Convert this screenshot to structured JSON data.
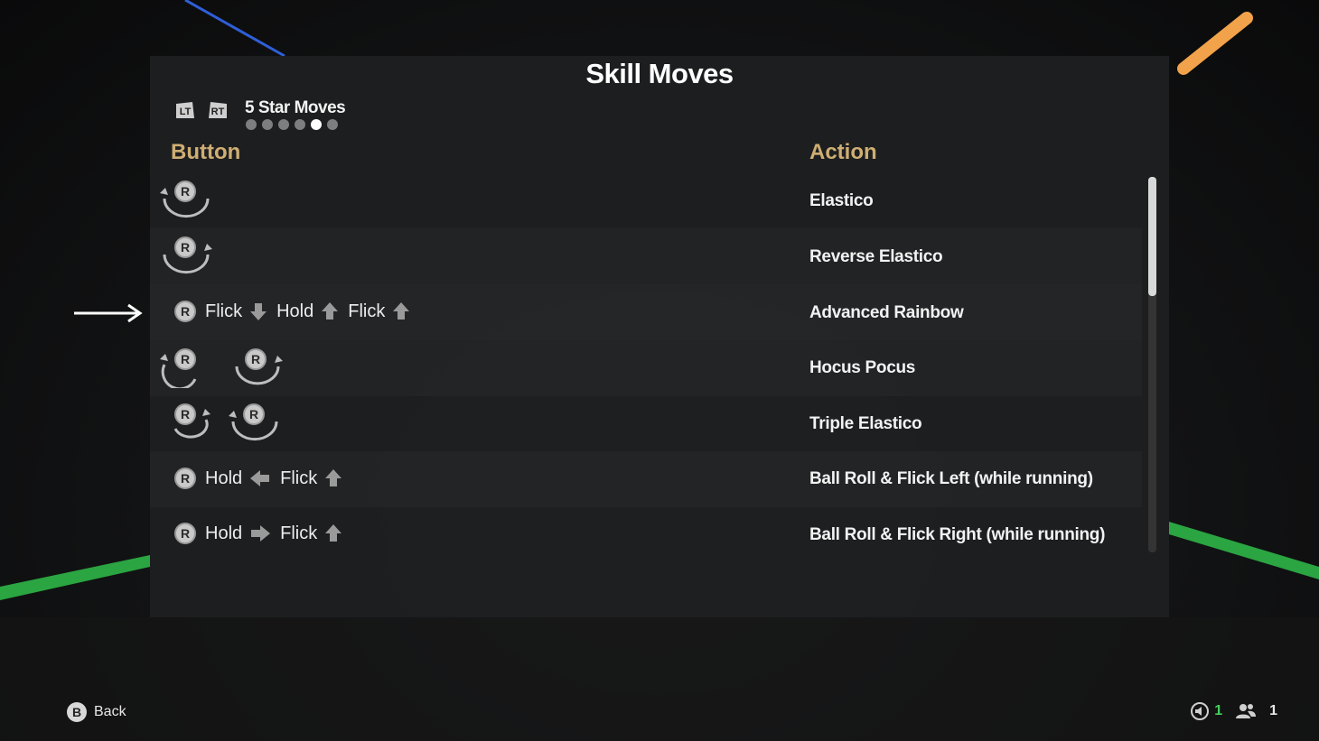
{
  "header": {
    "title": "Skill Moves",
    "left_bumper": "LT",
    "right_bumper": "RT",
    "current_tab": "5 Star Moves",
    "page_count": 6,
    "active_page": 5
  },
  "columns": {
    "button": "Button",
    "action": "Action"
  },
  "rows": [
    {
      "action": "Elastico"
    },
    {
      "action": "Reverse Elastico"
    },
    {
      "action": "Advanced Rainbow",
      "words": [
        "Flick",
        "Hold",
        "Flick"
      ]
    },
    {
      "action": "Hocus Pocus"
    },
    {
      "action": "Triple Elastico"
    },
    {
      "action": "Ball Roll & Flick Left (while running)",
      "words": [
        "Hold",
        "Flick"
      ]
    },
    {
      "action": "Ball Roll & Flick Right (while running)",
      "words": [
        "Hold",
        "Flick"
      ]
    }
  ],
  "stick_label": "R",
  "footer": {
    "back_button": "B",
    "back_label": "Back",
    "left_count": "1",
    "players_count": "1"
  },
  "colors": {
    "header_gold": "#cfae73",
    "accent_green": "#44d05c"
  }
}
